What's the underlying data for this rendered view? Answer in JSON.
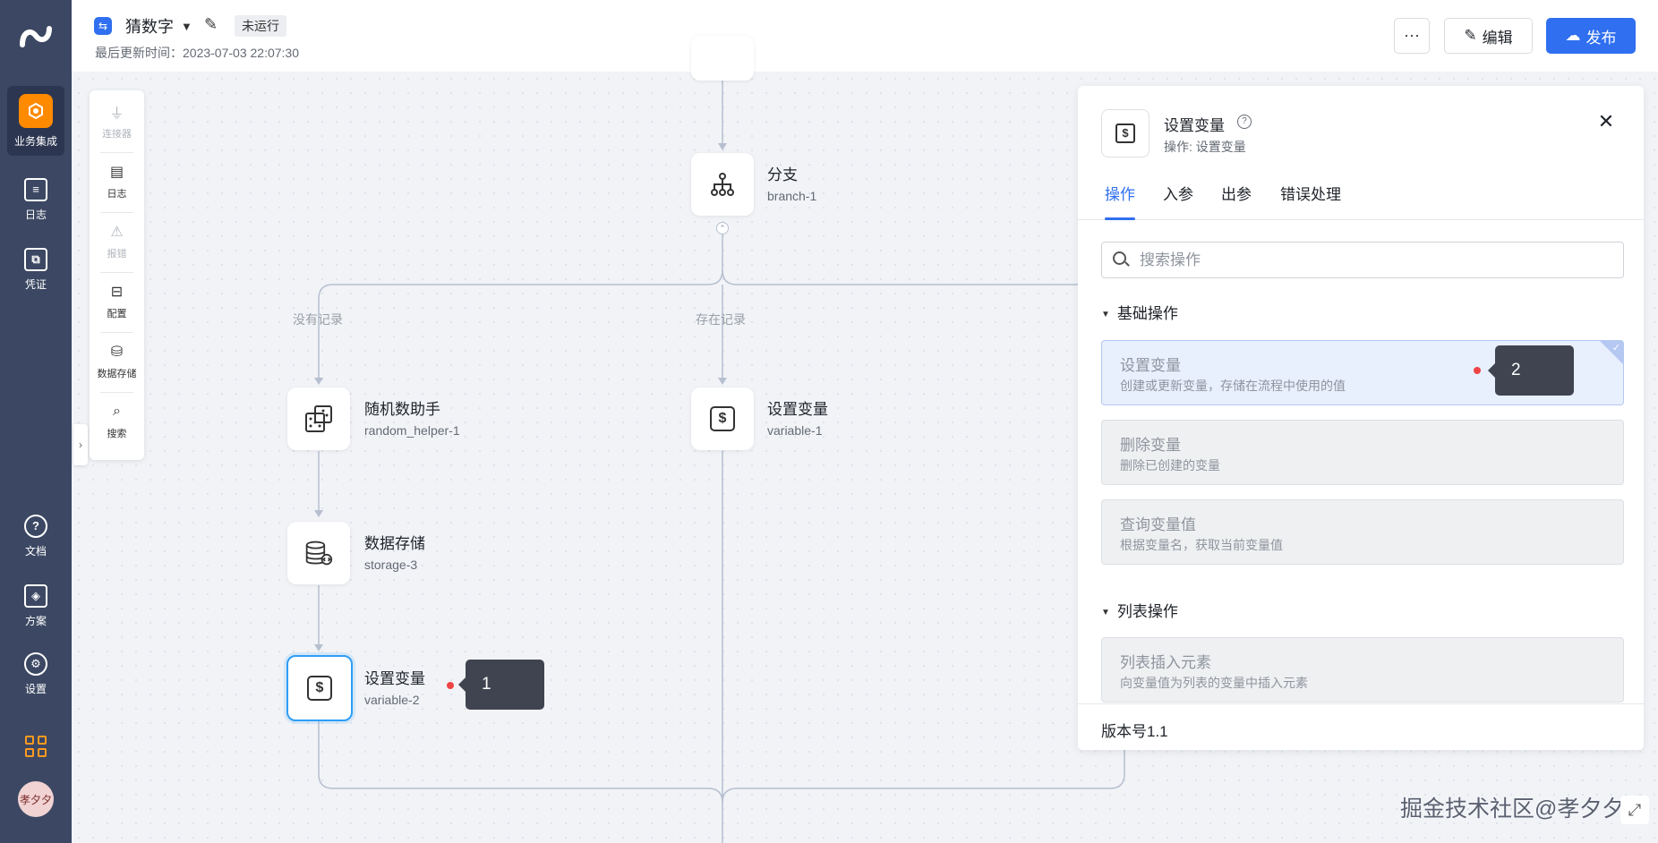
{
  "leftnav": {
    "items": [
      {
        "label": "业务集成",
        "icon": "integration-icon"
      },
      {
        "label": "日志",
        "icon": "log-icon"
      },
      {
        "label": "凭证",
        "icon": "credential-icon"
      },
      {
        "label": "文档",
        "icon": "help-icon"
      },
      {
        "label": "方案",
        "icon": "solution-icon"
      },
      {
        "label": "设置",
        "icon": "gear-icon"
      }
    ],
    "avatar_text": "孝夕夕"
  },
  "header": {
    "flow_name": "猜数字",
    "status": "未运行",
    "updated_at": "最后更新时间：2023-07-03 22:07:30",
    "more_label": "···",
    "edit_label": "编辑",
    "publish_label": "发布"
  },
  "toolbox": {
    "items": [
      {
        "label": "连接器",
        "icon": "plug-icon",
        "enabled": false
      },
      {
        "label": "日志",
        "icon": "log-icon",
        "enabled": true
      },
      {
        "label": "报错",
        "icon": "warning-icon",
        "enabled": false
      },
      {
        "label": "配置",
        "icon": "config-icon",
        "enabled": true
      },
      {
        "label": "数据存储",
        "icon": "database-icon",
        "enabled": true
      },
      {
        "label": "搜索",
        "icon": "search-icon",
        "enabled": true
      }
    ]
  },
  "canvas": {
    "nodes": {
      "branch": {
        "title": "分支",
        "id": "branch-1",
        "icon": "branch-icon"
      },
      "random": {
        "title": "随机数助手",
        "id": "random_helper-1",
        "icon": "dice-icon"
      },
      "storage": {
        "title": "数据存储",
        "id": "storage-3",
        "icon": "database-icon"
      },
      "var2": {
        "title": "设置变量",
        "id": "variable-2",
        "icon": "dollar-icon"
      },
      "var1": {
        "title": "设置变量",
        "id": "variable-1",
        "icon": "dollar-icon"
      }
    },
    "branch_labels": {
      "left": "没有记录",
      "middle": "存在记录"
    },
    "annotation_1": "1",
    "annotation_2": "2",
    "watermark": "掘金技术社区@孝夕夕"
  },
  "panel": {
    "title": "设置变量",
    "subtitle": "操作: 设置变量",
    "tabs": [
      "操作",
      "入参",
      "出参",
      "错误处理"
    ],
    "active_tab": 0,
    "search_placeholder": "搜索操作",
    "sections": [
      {
        "title": "基础操作",
        "items": [
          {
            "title": "设置变量",
            "desc": "创建或更新变量，存储在流程中使用的值",
            "selected": true
          },
          {
            "title": "删除变量",
            "desc": "删除已创建的变量",
            "selected": false
          },
          {
            "title": "查询变量值",
            "desc": "根据变量名，获取当前变量值",
            "selected": false
          }
        ]
      },
      {
        "title": "列表操作",
        "items": [
          {
            "title": "列表插入元素",
            "desc": "向变量值为列表的变量中插入元素",
            "selected": false
          }
        ]
      }
    ],
    "version": "版本号1.1"
  },
  "colors": {
    "primary": "#2f6ff0",
    "nav_bg": "#3c4863",
    "accent": "#ff8a00",
    "selected_node": "#2f9ef5"
  }
}
